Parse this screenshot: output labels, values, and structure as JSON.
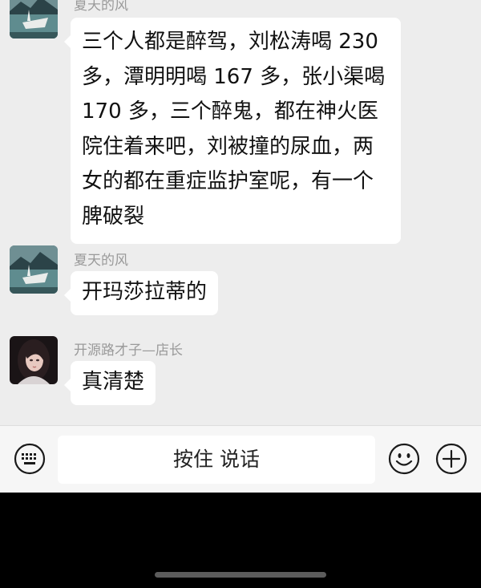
{
  "messages": [
    {
      "sender": "夏天的风",
      "avatar": "landscape-boat-avatar",
      "lines": [
        "三个人都是醉驾，刘松涛喝 230",
        "多，潭明明喝 167 多，张小渠喝",
        "170 多，三个醉鬼，都在神火医",
        "院住着来吧，刘被撞的尿血，两",
        "女的都在重症监护室呢，有一个",
        "脾破裂"
      ]
    },
    {
      "sender": "夏天的风",
      "avatar": "landscape-boat-avatar",
      "lines": [
        "开玛莎拉蒂的"
      ]
    },
    {
      "sender": "开源路才子—店长",
      "avatar": "girl-portrait-avatar",
      "lines": [
        "真清楚"
      ]
    }
  ],
  "input_bar": {
    "hold_to_talk_label": "按住 说话",
    "left_icon": "keyboard-icon",
    "right_icons": [
      "emoji-icon",
      "plus-icon"
    ]
  }
}
